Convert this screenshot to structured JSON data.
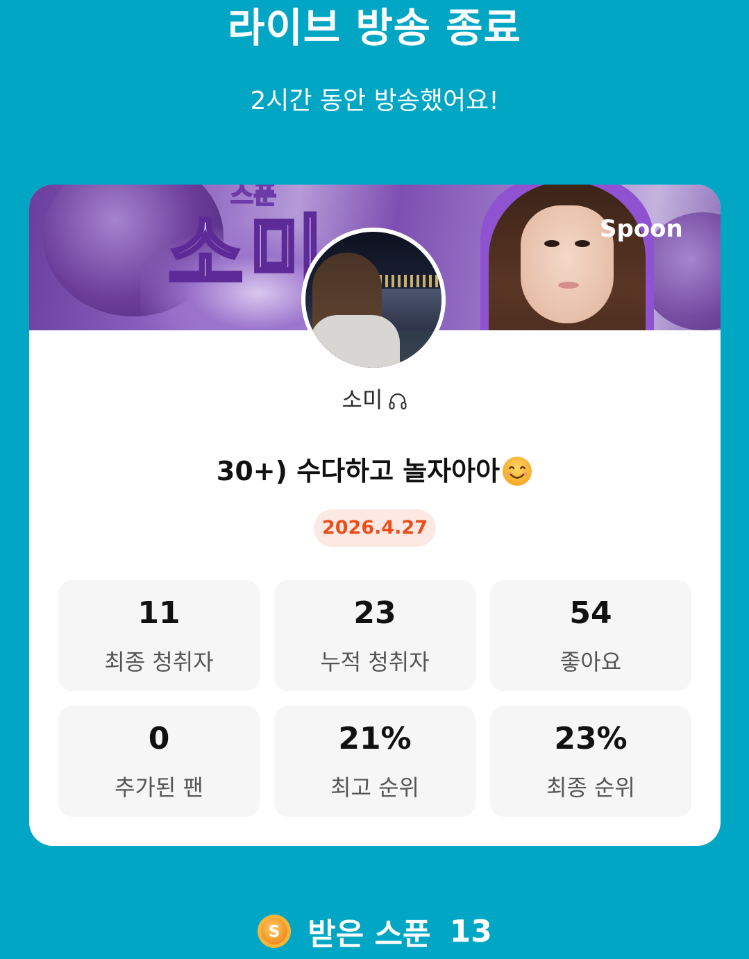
{
  "header": {
    "title": "라이브 방송 종료",
    "subtitle": "2시간 동안 방송했어요!"
  },
  "card": {
    "banner": {
      "small_name": "스푼",
      "big_name": "소미",
      "brand": "Spoon"
    },
    "host_name": "소미",
    "host_icon": "headphone-icon",
    "live_title": "30+) 수다하고 놀자아아",
    "live_title_emoji": "smiling-face-icon",
    "date": "2026.4.27",
    "stats": [
      {
        "value": "11",
        "label": "최종 청취자"
      },
      {
        "value": "23",
        "label": "누적 청취자"
      },
      {
        "value": "54",
        "label": "좋아요"
      },
      {
        "value": "0",
        "label": "추가된 팬"
      },
      {
        "value": "21%",
        "label": "최고 순위"
      },
      {
        "value": "23%",
        "label": "최종 순위"
      }
    ]
  },
  "footer": {
    "coin_icon": "spoon-coin-icon",
    "received_label": "받은 스푼",
    "received_count": "13"
  },
  "colors": {
    "background": "#00a6c4",
    "date_badge_bg": "#fde9e4",
    "date_badge_text": "#ec4e1b",
    "stat_box_bg": "#f6f6f6"
  }
}
